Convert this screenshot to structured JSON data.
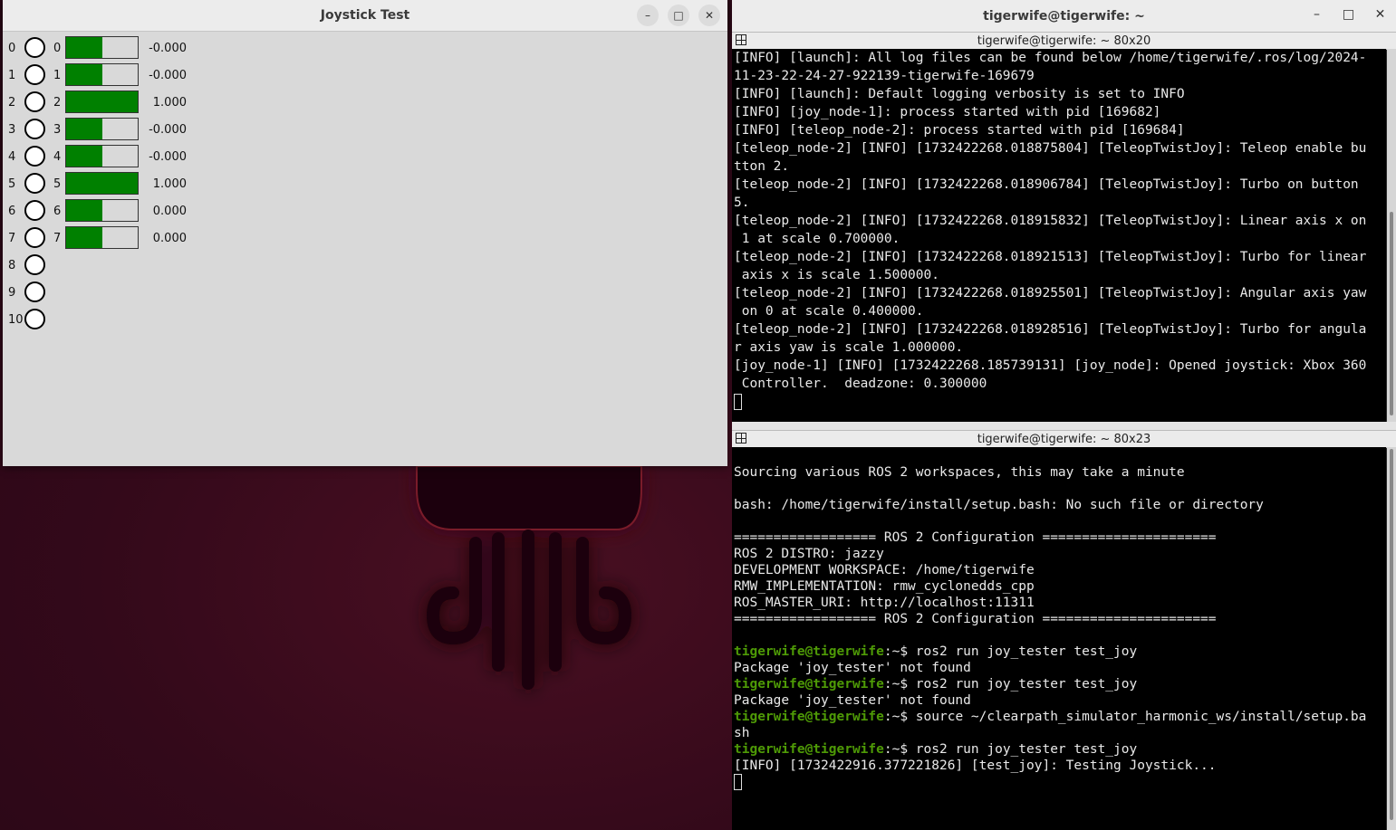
{
  "joystick_window": {
    "title": "Joystick Test",
    "controls": [
      "–",
      "□",
      "✕"
    ],
    "rows": [
      {
        "button": "0",
        "axis": "0",
        "value": "-0.000",
        "fill": 0.5
      },
      {
        "button": "1",
        "axis": "1",
        "value": "-0.000",
        "fill": 0.5
      },
      {
        "button": "2",
        "axis": "2",
        "value": "1.000",
        "fill": 1.0
      },
      {
        "button": "3",
        "axis": "3",
        "value": "-0.000",
        "fill": 0.5
      },
      {
        "button": "4",
        "axis": "4",
        "value": "-0.000",
        "fill": 0.5
      },
      {
        "button": "5",
        "axis": "5",
        "value": "1.000",
        "fill": 1.0
      },
      {
        "button": "6",
        "axis": "6",
        "value": "0.000",
        "fill": 0.5
      },
      {
        "button": "7",
        "axis": "7",
        "value": "0.000",
        "fill": 0.5
      },
      {
        "button": "8"
      },
      {
        "button": "9"
      },
      {
        "button": "10"
      }
    ],
    "colors": {
      "bar_fill": "#008000"
    }
  },
  "terminal_window": {
    "title": "tigerwife@tigerwife: ~",
    "controls": [
      "–",
      "□",
      "✕"
    ],
    "pane1": {
      "title": "tigerwife@tigerwife: ~ 80x20",
      "lines": [
        "[INFO] [launch]: All log files can be found below /home/tigerwife/.ros/log/2024-",
        "11-23-22-24-27-922139-tigerwife-169679",
        "[INFO] [launch]: Default logging verbosity is set to INFO",
        "[INFO] [joy_node-1]: process started with pid [169682]",
        "[INFO] [teleop_node-2]: process started with pid [169684]",
        "[teleop_node-2] [INFO] [1732422268.018875804] [TeleopTwistJoy]: Teleop enable bu",
        "tton 2.",
        "[teleop_node-2] [INFO] [1732422268.018906784] [TeleopTwistJoy]: Turbo on button ",
        "5.",
        "[teleop_node-2] [INFO] [1732422268.018915832] [TeleopTwistJoy]: Linear axis x on",
        " 1 at scale 0.700000.",
        "[teleop_node-2] [INFO] [1732422268.018921513] [TeleopTwistJoy]: Turbo for linear",
        " axis x is scale 1.500000.",
        "[teleop_node-2] [INFO] [1732422268.018925501] [TeleopTwistJoy]: Angular axis yaw",
        " on 0 at scale 0.400000.",
        "[teleop_node-2] [INFO] [1732422268.018928516] [TeleopTwistJoy]: Turbo for angula",
        "r axis yaw is scale 1.000000.",
        "[joy_node-1] [INFO] [1732422268.185739131] [joy_node]: Opened joystick: Xbox 360",
        " Controller.  deadzone: 0.300000"
      ]
    },
    "pane2": {
      "title": "tigerwife@tigerwife: ~ 80x23",
      "lines_before": [
        "Sourcing various ROS 2 workspaces, this may take a minute",
        "",
        "bash: /home/tigerwife/install/setup.bash: No such file or directory",
        "",
        "================== ROS 2 Configuration ======================",
        "ROS 2 DISTRO: jazzy",
        "DEVELOPMENT WORKSPACE: /home/tigerwife",
        "RMW_IMPLEMENTATION: rmw_cyclonedds_cpp",
        "ROS_MASTER_URI: http://localhost:11311",
        "================== ROS 2 Configuration ======================",
        ""
      ],
      "prompt_user": "tigerwife@tigerwife",
      "prompt_path": ":~$ ",
      "session": [
        {
          "cmd": "ros2 run joy_tester test_joy",
          "out": [
            "Package 'joy_tester' not found"
          ]
        },
        {
          "cmd": "ros2 run joy_tester test_joy",
          "out": [
            "Package 'joy_tester' not found"
          ]
        },
        {
          "cmd": "source ~/clearpath_simulator_harmonic_ws/install/setup.ba",
          "cont": "sh",
          "out": []
        },
        {
          "cmd": "ros2 run joy_tester test_joy",
          "out": [
            "[INFO] [1732422916.377221826] [test_joy]: Testing Joystick..."
          ]
        }
      ]
    }
  }
}
